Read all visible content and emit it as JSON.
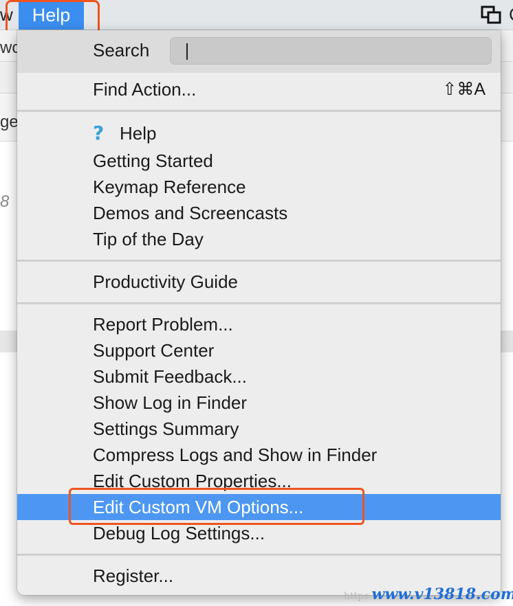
{
  "menubar": {
    "left_fragment": "w",
    "help_label": "Help",
    "right_fragment": "C"
  },
  "background": {
    "frag_top": "wo",
    "frag_tab": "ge.",
    "line_number": "8"
  },
  "menu": {
    "search_label": "Search",
    "search_value": "",
    "find_action": {
      "label": "Find Action...",
      "shortcut": "⇧⌘A"
    },
    "help_item": "Help",
    "group1": [
      "Getting Started",
      "Keymap Reference",
      "Demos and Screencasts",
      "Tip of the Day"
    ],
    "productivity_guide": "Productivity Guide",
    "group3": [
      "Report Problem...",
      "Support Center",
      "Submit Feedback...",
      "Show Log in Finder",
      "Settings Summary",
      "Compress Logs and Show in Finder",
      "Edit Custom Properties..."
    ],
    "selected_item": "Edit Custom VM Options...",
    "debug_log": "Debug Log Settings...",
    "register": "Register..."
  },
  "colors": {
    "highlight": "#4d97f2",
    "annotation_outline": "#f0531f",
    "help_menu_active": "#3b8ef0"
  },
  "watermark": {
    "ghost": "https",
    "text": "www.v13818.com"
  }
}
